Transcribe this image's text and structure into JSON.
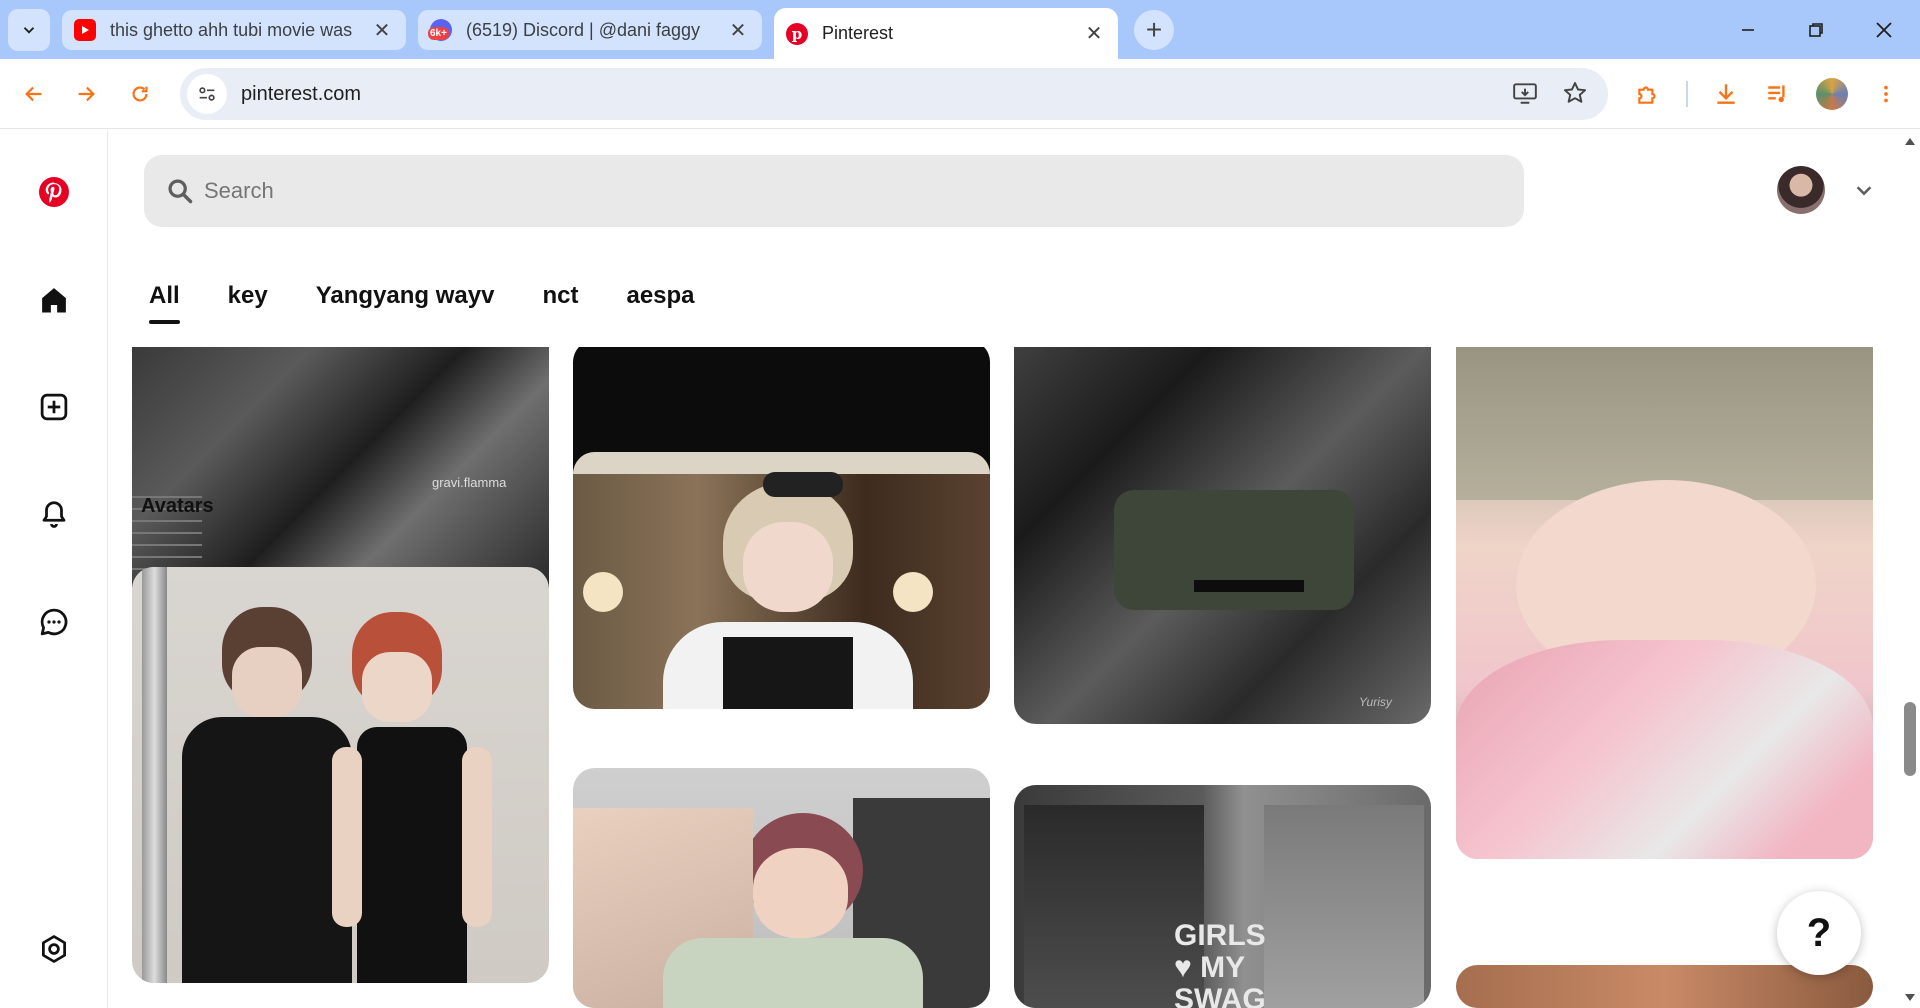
{
  "browser": {
    "tabs": [
      {
        "title": "this ghetto ahh tubi movie was",
        "icon": "youtube-icon",
        "active": false
      },
      {
        "title": "(6519) Discord | @dani faggy",
        "icon": "discord-icon",
        "badge": "6k+",
        "active": false
      },
      {
        "title": "Pinterest",
        "icon": "pinterest-icon",
        "active": true
      }
    ],
    "url": "pinterest.com",
    "accent": "#f97316",
    "tabstrip_color": "#a8c7fa"
  },
  "search": {
    "placeholder": "Search",
    "value": ""
  },
  "filter_tabs": [
    {
      "label": "All",
      "selected": true
    },
    {
      "label": "key",
      "selected": false
    },
    {
      "label": "Yangyang wayv",
      "selected": false
    },
    {
      "label": "nct",
      "selected": false
    },
    {
      "label": "aespa",
      "selected": false
    }
  ],
  "pins": {
    "col1_top_caption": "Avatars",
    "col1_top_label": "gravi.flamma",
    "col3_bottom_overlay": "GIRLS ♥ MY SWAG",
    "col3_top_watermark": "Yurisy"
  },
  "help": {
    "label": "?"
  },
  "brand_color": "#e60023"
}
